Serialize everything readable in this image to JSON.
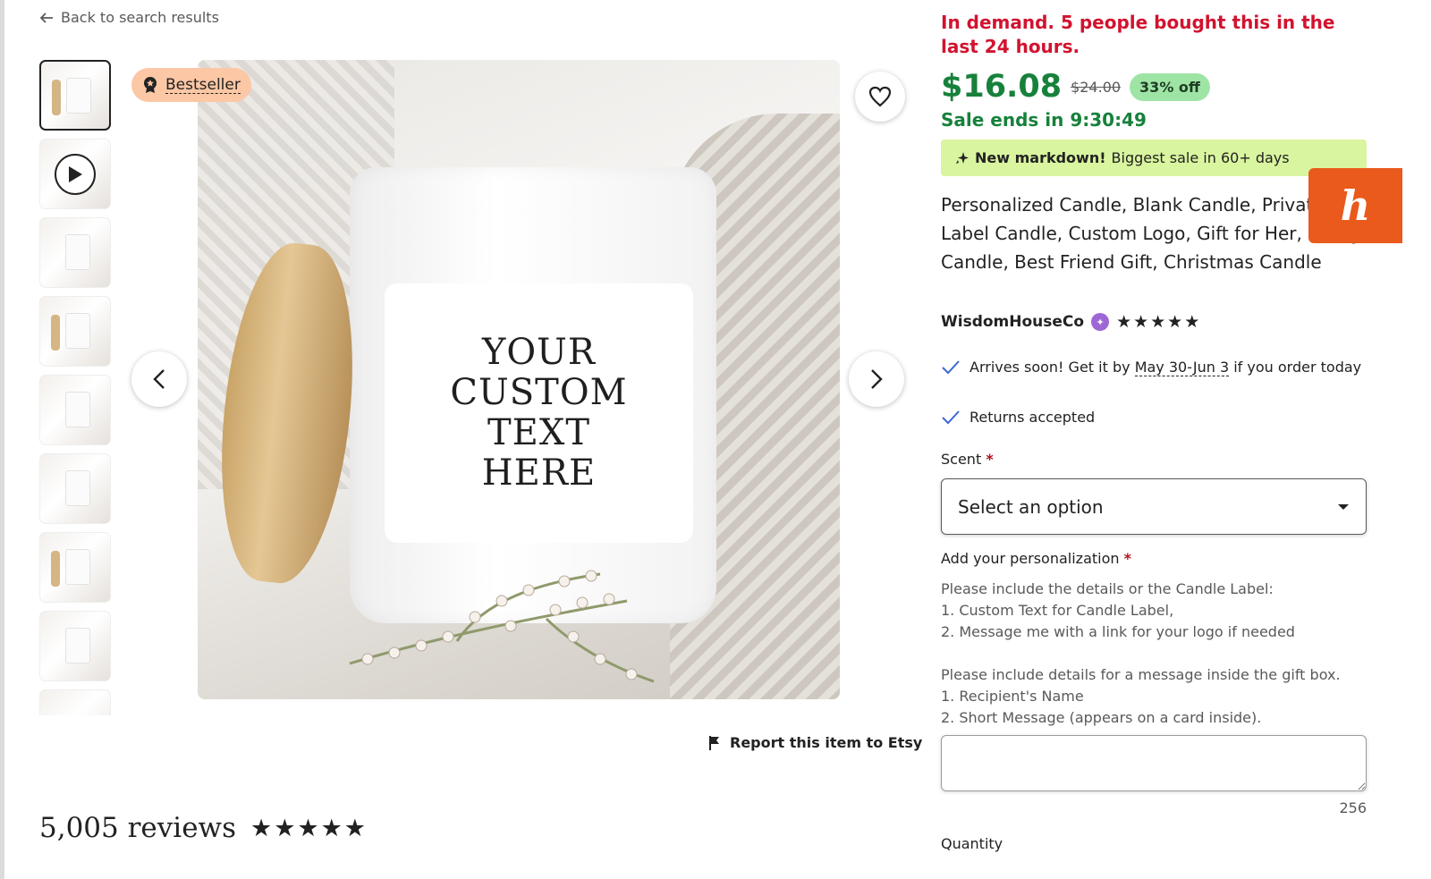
{
  "nav": {
    "back_label": "Back to search results"
  },
  "gallery": {
    "badge": "Bestseller",
    "image_label_text": "YOUR\nCUSTOM\nTEXT\nHERE",
    "thumbnail_count": 9
  },
  "report": {
    "label": "Report this item to Etsy"
  },
  "reviews": {
    "count_label": "5,005 reviews",
    "stars": "★★★★★"
  },
  "listing": {
    "demand_text": "In demand. 5 people bought this in the last 24 hours.",
    "price": "$16.08",
    "original_price": "$24.00",
    "discount": "33% off",
    "sale_ends": "Sale ends in 9:30:49",
    "markdown_bold": "New markdown!",
    "markdown_text": "Biggest sale in 60+ days",
    "title": "Personalized Candle, Blank Candle, Private Label Candle, Custom Logo, Gift for Her, Funny Candle, Best Friend Gift, Christmas Candle",
    "seller": "WisdomHouseCo",
    "seller_stars": "★★★★★",
    "arrives_prefix": "Arrives soon! Get it by",
    "arrives_dates": "May 30-Jun 3",
    "arrives_suffix": "if you order today",
    "returns": "Returns accepted"
  },
  "form": {
    "scent_label": "Scent",
    "required_mark": "*",
    "scent_placeholder": "Select an option",
    "personalization_label": "Add your personalization",
    "instructions": "Please include the details or the Candle Label:\n1. Custom Text for Candle Label,\n2. Message me with a link for your logo if needed\n\nPlease include details for a message inside the gift box.\n1. Recipient's Name\n2. Short Message (appears on a card inside).",
    "char_count": "256",
    "quantity_label": "Quantity"
  },
  "colors": {
    "demand_red": "#d1132f",
    "price_green": "#17813b",
    "discount_bg": "#9ee5a5",
    "markdown_bg": "#d9f59f",
    "badge_bg": "#fbc7a4",
    "honey_orange": "#e95a1c"
  },
  "extension": {
    "honey_glyph": "h"
  }
}
